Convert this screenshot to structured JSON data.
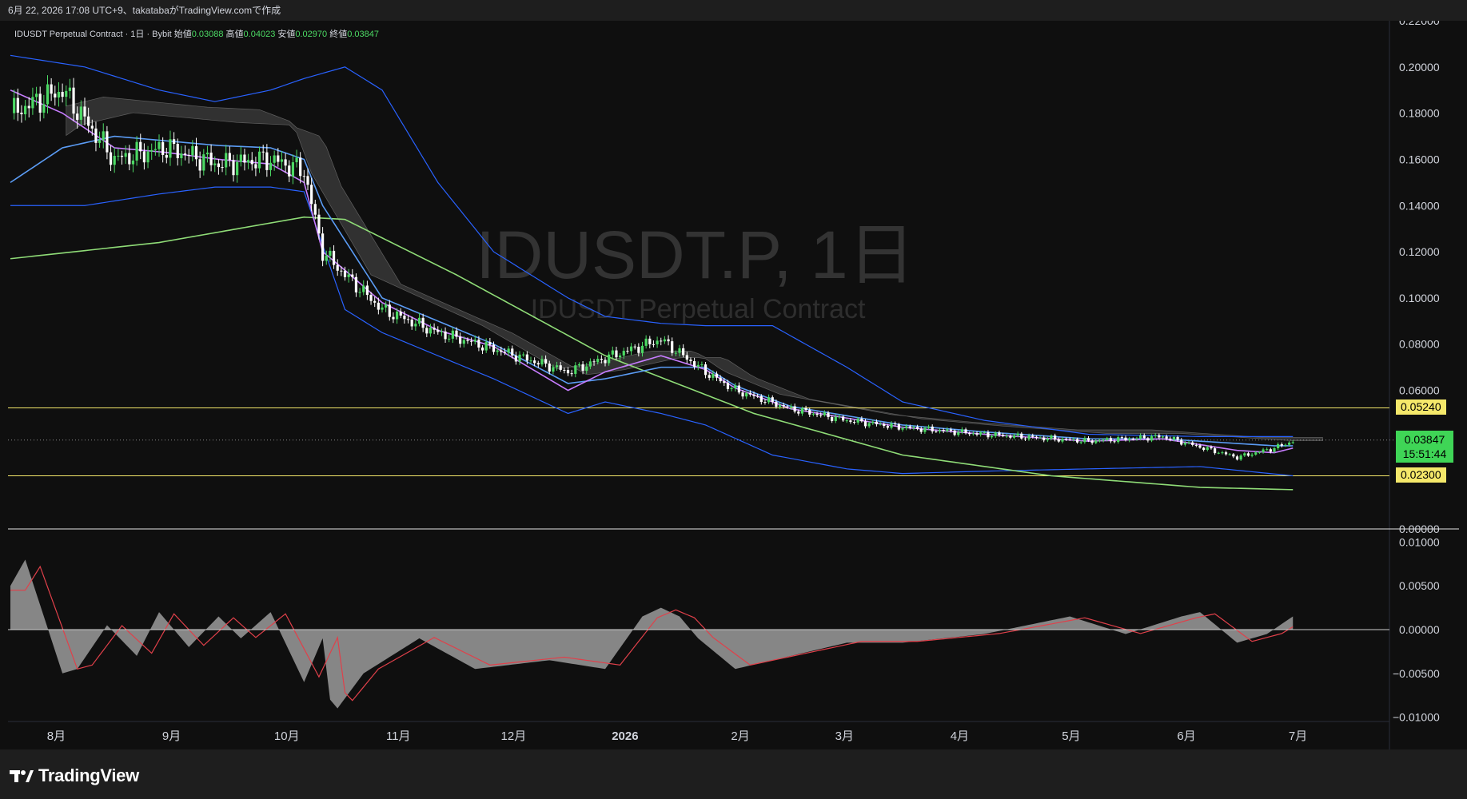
{
  "header": {
    "attribution": "6月 22, 2026 17:08 UTC+9、takatabaがTradingView.comで作成"
  },
  "legend": {
    "symbol": "IDUSDT Perpetual Contract · 1日 · Bybit",
    "open_label": "始値",
    "open_value": "0.03088",
    "high_label": "高値",
    "high_value": "0.04023",
    "low_label": "安値",
    "low_value": "0.02970",
    "close_label": "終値",
    "close_value": "0.03847"
  },
  "watermark": {
    "ticker": "IDUSDT.P, 1日",
    "description": "IDUSDT Perpetual Contract"
  },
  "price_tags": {
    "upper_level": "0.05240",
    "current_price": "0.03847",
    "countdown": "15:51:44",
    "lower_level": "0.02300"
  },
  "footer": {
    "brand": "TradingView"
  },
  "colors": {
    "background": "#0f0f0f",
    "candle_up": "#4cd964",
    "candle_down": "#ffffff",
    "bollinger": "#2962ff",
    "ma_short": "#c77dff",
    "ma_mid": "#5b9cf5",
    "ma_long": "#8fdc77",
    "cloud": "#5a5a5a",
    "level_line": "#f5e86a",
    "histogram": "#9b9b9b",
    "signal": "#e0404a"
  },
  "chart_data": {
    "type": "line",
    "title": "IDUSDT.P, 1日",
    "price_axis": {
      "ylim": [
        0.0,
        0.22
      ],
      "ticks": [
        "0.22000",
        "0.20000",
        "0.18000",
        "0.16000",
        "0.14000",
        "0.12000",
        "0.10000",
        "0.08000",
        "0.06000",
        "0.00000"
      ]
    },
    "osc_axis": {
      "ylim": [
        -0.0105,
        0.0115
      ],
      "ticks": [
        "0.01000",
        "0.00500",
        "0.00000",
        "−0.00500",
        "−0.01000"
      ]
    },
    "x_ticks": [
      "8月",
      "9月",
      "10月",
      "11月",
      "12月",
      "2026",
      "2月",
      "3月",
      "4月",
      "5月",
      "6月",
      "7月"
    ],
    "horizontal_levels": [
      0.0524,
      0.023
    ],
    "last_price": 0.03847,
    "series": [
      {
        "name": "price",
        "x": [
          0,
          14,
          28,
          42,
          56,
          70,
          79,
          84,
          90,
          100,
          115,
          130,
          150,
          160,
          175,
          187,
          195,
          210,
          225,
          240,
          262,
          290,
          310,
          330,
          340,
          345
        ],
        "values": [
          0.18,
          0.19,
          0.16,
          0.165,
          0.158,
          0.16,
          0.155,
          0.12,
          0.11,
          0.095,
          0.085,
          0.078,
          0.068,
          0.074,
          0.082,
          0.068,
          0.06,
          0.052,
          0.047,
          0.044,
          0.041,
          0.038,
          0.04,
          0.031,
          0.035,
          0.038
        ]
      },
      {
        "name": "ma_short",
        "x": [
          0,
          14,
          28,
          42,
          56,
          70,
          79,
          84,
          90,
          100,
          115,
          130,
          150,
          160,
          175,
          187,
          195,
          210,
          225,
          240,
          262,
          290,
          310,
          330,
          340,
          345
        ],
        "values": [
          0.19,
          0.18,
          0.165,
          0.163,
          0.16,
          0.158,
          0.15,
          0.12,
          0.112,
          0.098,
          0.086,
          0.079,
          0.06,
          0.068,
          0.075,
          0.069,
          0.061,
          0.052,
          0.048,
          0.044,
          0.041,
          0.038,
          0.039,
          0.034,
          0.033,
          0.035
        ]
      },
      {
        "name": "ma_mid",
        "x": [
          0,
          14,
          28,
          42,
          56,
          70,
          79,
          84,
          90,
          100,
          115,
          130,
          150,
          160,
          175,
          187,
          195,
          210,
          225,
          240,
          262,
          290,
          310,
          330,
          340,
          345
        ],
        "values": [
          0.15,
          0.165,
          0.17,
          0.168,
          0.166,
          0.165,
          0.16,
          0.14,
          0.125,
          0.1,
          0.09,
          0.08,
          0.063,
          0.065,
          0.07,
          0.07,
          0.062,
          0.053,
          0.049,
          0.045,
          0.042,
          0.039,
          0.039,
          0.037,
          0.036,
          0.036
        ]
      },
      {
        "name": "ma_long",
        "x": [
          0,
          40,
          79,
          90,
          120,
          160,
          200,
          240,
          280,
          320,
          345
        ],
        "values": [
          0.117,
          0.124,
          0.135,
          0.134,
          0.11,
          0.075,
          0.05,
          0.032,
          0.023,
          0.018,
          0.017
        ]
      },
      {
        "name": "bollinger_upper",
        "x": [
          0,
          20,
          40,
          55,
          70,
          79,
          90,
          100,
          115,
          130,
          150,
          160,
          175,
          187,
          205,
          225,
          240,
          262,
          290,
          320,
          345
        ],
        "values": [
          0.205,
          0.2,
          0.19,
          0.185,
          0.19,
          0.195,
          0.2,
          0.19,
          0.15,
          0.12,
          0.1,
          0.092,
          0.089,
          0.088,
          0.088,
          0.07,
          0.055,
          0.047,
          0.041,
          0.04,
          0.04
        ]
      },
      {
        "name": "bollinger_lower",
        "x": [
          0,
          20,
          40,
          55,
          70,
          79,
          90,
          100,
          115,
          130,
          150,
          160,
          175,
          187,
          205,
          225,
          240,
          262,
          290,
          320,
          345
        ],
        "values": [
          0.14,
          0.14,
          0.145,
          0.148,
          0.148,
          0.146,
          0.095,
          0.085,
          0.075,
          0.065,
          0.05,
          0.055,
          0.05,
          0.045,
          0.032,
          0.026,
          0.024,
          0.025,
          0.026,
          0.027,
          0.023
        ]
      },
      {
        "name": "oscillator",
        "x": [
          0,
          4,
          14,
          18,
          26,
          34,
          40,
          48,
          56,
          62,
          70,
          79,
          84,
          86,
          88,
          95,
          110,
          125,
          145,
          160,
          170,
          175,
          180,
          185,
          195,
          210,
          225,
          240,
          262,
          285,
          300,
          315,
          320,
          330,
          338,
          345
        ],
        "values": [
          0.005,
          0.008,
          -0.005,
          -0.0045,
          0.0005,
          -0.003,
          0.002,
          -0.002,
          0.0015,
          -0.001,
          0.002,
          -0.006,
          -0.001,
          -0.008,
          -0.009,
          -0.005,
          -0.001,
          -0.0045,
          -0.0035,
          -0.0045,
          0.0015,
          0.0025,
          0.0015,
          -0.001,
          -0.0045,
          -0.003,
          -0.0015,
          -0.0015,
          -0.0005,
          0.0015,
          -0.0005,
          0.0015,
          0.002,
          -0.0015,
          -0.0005,
          0.0015
        ]
      }
    ]
  }
}
